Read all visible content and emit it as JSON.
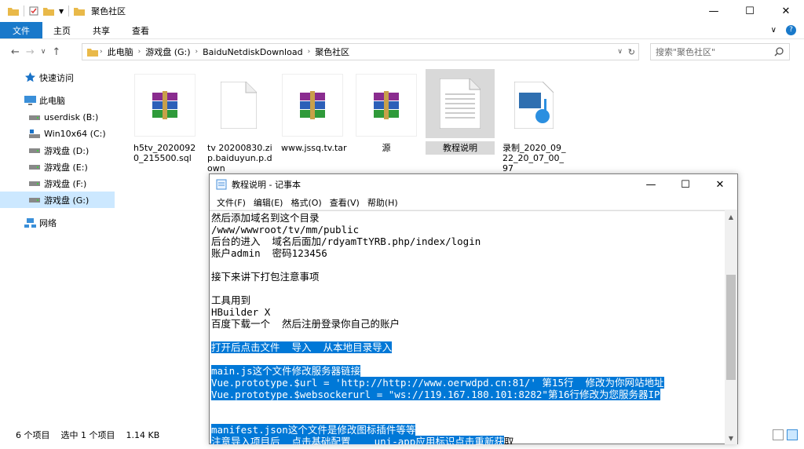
{
  "explorer": {
    "title": "聚色社区",
    "ribbon_tabs": [
      "文件",
      "主页",
      "共享",
      "查看"
    ],
    "nav": {
      "back": "←",
      "forward": "→",
      "recent": "∨",
      "up": "↑"
    },
    "breadcrumb": [
      "此电脑",
      "游戏盘 (G:)",
      "BaiduNetdiskDownload",
      "聚色社区"
    ],
    "search_placeholder": "搜索\"聚色社区\"",
    "sidebar": [
      {
        "label": "快速访问",
        "icon": "star-icon"
      },
      {
        "label": "此电脑",
        "icon": "computer-icon"
      },
      {
        "label": "userdisk (B:)",
        "icon": "drive-icon"
      },
      {
        "label": "Win10x64 (C:)",
        "icon": "windows-drive-icon"
      },
      {
        "label": "游戏盘 (D:)",
        "icon": "drive-icon"
      },
      {
        "label": "游戏盘 (E:)",
        "icon": "drive-icon"
      },
      {
        "label": "游戏盘 (F:)",
        "icon": "drive-icon"
      },
      {
        "label": "游戏盘 (G:)",
        "icon": "drive-icon"
      },
      {
        "label": "网络",
        "icon": "network-icon"
      }
    ],
    "files": [
      {
        "name": "h5tv_20200920_215500.sql",
        "icon": "winrar-icon"
      },
      {
        "name": "tv 20200830.zip.baiduyun.p.down",
        "icon": "blank-file-icon"
      },
      {
        "name": "www.jssq.tv.tar",
        "icon": "winrar-icon"
      },
      {
        "name": "源",
        "icon": "winrar-icon"
      },
      {
        "name": "教程说明",
        "icon": "text-file-icon"
      },
      {
        "name": "录制_2020_09_22_20_07_00_97",
        "icon": "media-file-icon"
      }
    ],
    "status": {
      "count": "6 个项目",
      "selected": "选中 1 个项目",
      "size": "1.14 KB"
    }
  },
  "notepad": {
    "title": "教程说明 - 记事本",
    "menu": [
      "文件(F)",
      "编辑(E)",
      "格式(O)",
      "查看(V)",
      "帮助(H)"
    ],
    "lines": [
      {
        "text": "然后添加域名到这个目录",
        "sel": ""
      },
      {
        "text": "/www/wwwroot/tv/mm/public",
        "sel": ""
      },
      {
        "text": "后台的进入  域名后面加/rdyamTtYRB.php/index/login",
        "sel": ""
      },
      {
        "text": "账户admin  密码123456",
        "sel": ""
      },
      {
        "text": "",
        "sel": ""
      },
      {
        "text": "接下来讲下打包注意事项",
        "sel": ""
      },
      {
        "text": "",
        "sel": ""
      },
      {
        "text": "工具用到",
        "sel": ""
      },
      {
        "text": "HBuilder X",
        "sel": ""
      },
      {
        "text": "百度下载一个  然后注册登录你自己的账户",
        "sel": ""
      },
      {
        "text": "",
        "sel": ""
      },
      {
        "text": "",
        "sel": "打开后点击文件  导入  从本地目录导入"
      },
      {
        "text": "",
        "sel": ""
      },
      {
        "text": "",
        "sel": "main.js这个文件修改服务器链接"
      },
      {
        "text": "",
        "sel": "Vue.prototype.$url = 'http://http://www.oerwdpd.cn:81/' 第15行  修改为你网站地址"
      },
      {
        "text": "",
        "sel": "Vue.prototype.$websockerurl = \"ws://119.167.180.101:8282\"第16行修改为您服务器IP"
      },
      {
        "text": "",
        "sel": ""
      },
      {
        "text": "",
        "sel": ""
      },
      {
        "text": "",
        "sel": "manifest.json这个文件是修改图标插件等等"
      },
      {
        "text": "取",
        "sel": "注意导入项目后  点击基础配置    uni-app应用标识点击重新获"
      }
    ]
  }
}
